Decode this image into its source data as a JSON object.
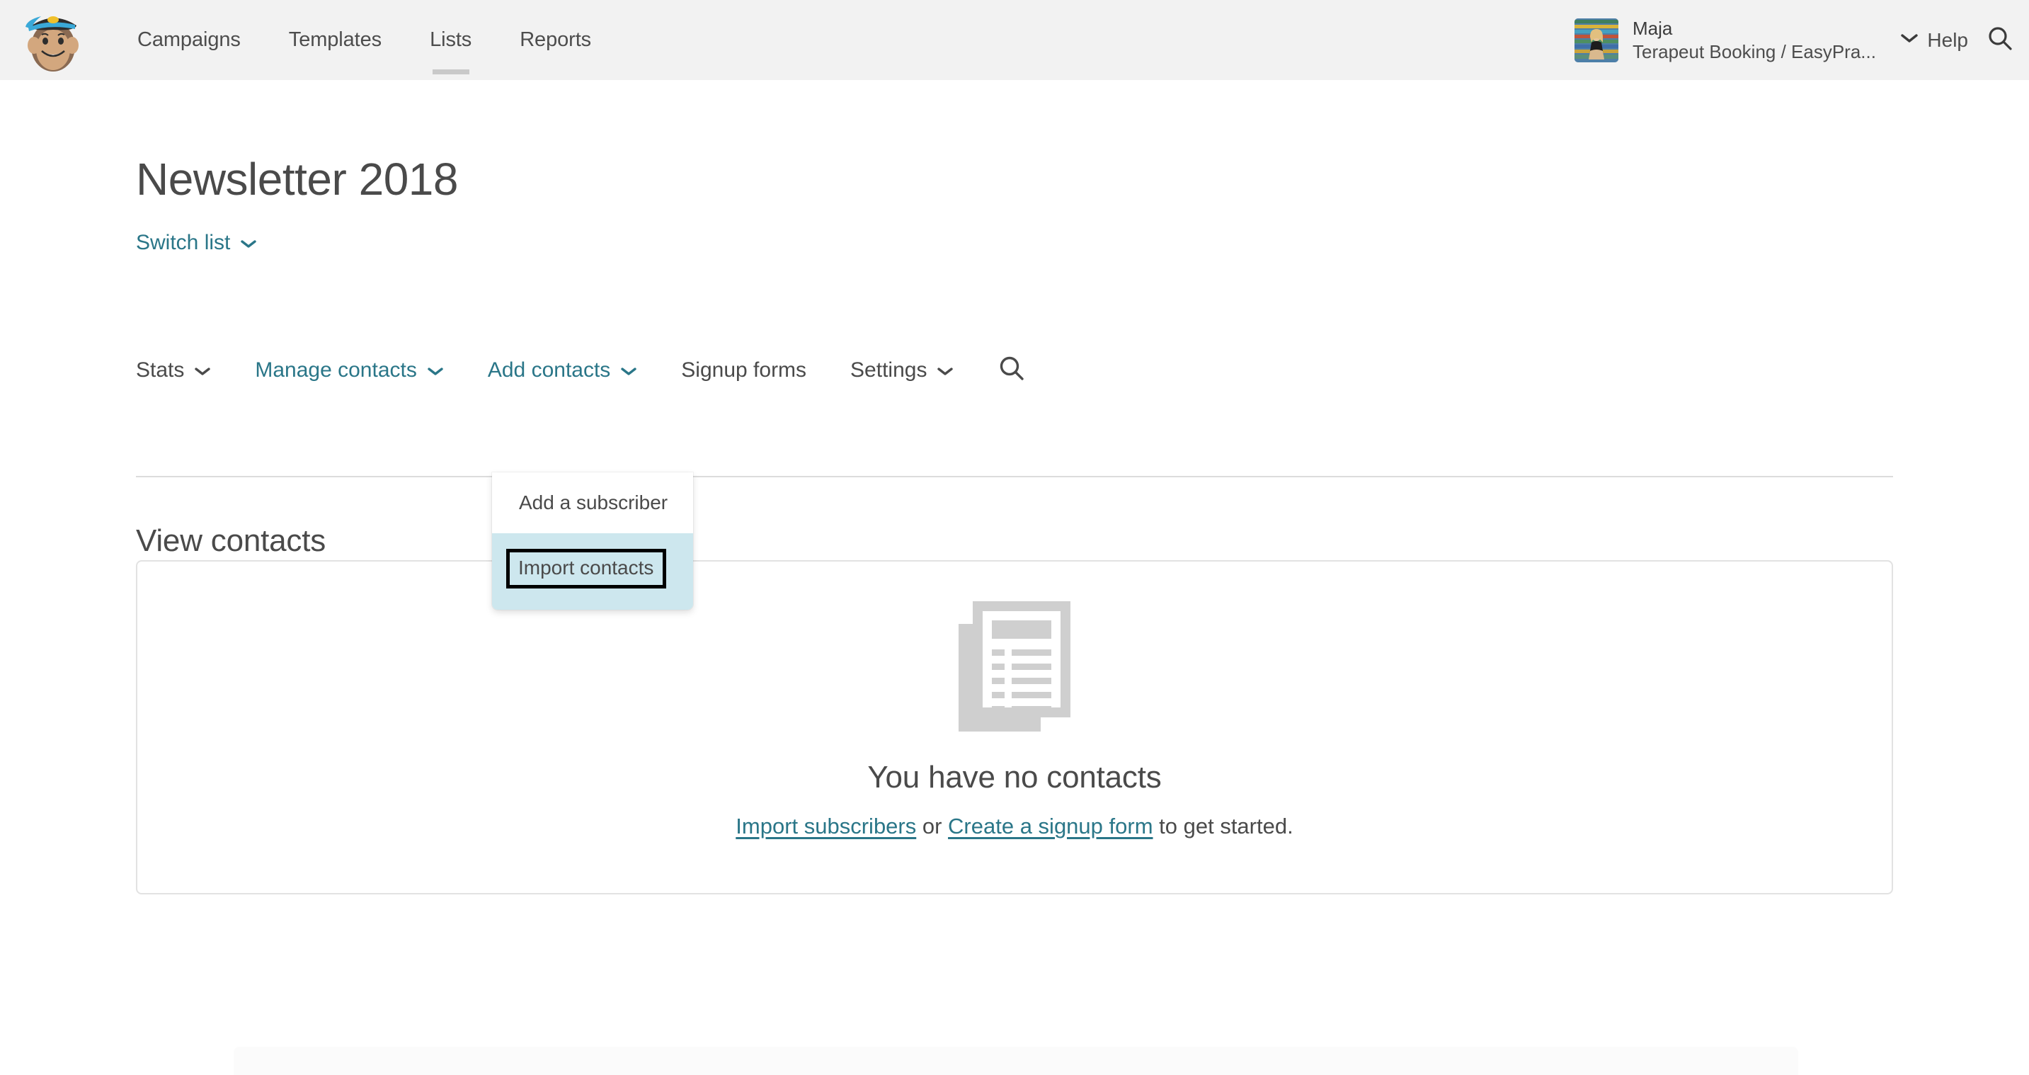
{
  "topnav": {
    "logo_icon": "mailchimp-freddie-logo",
    "items": [
      {
        "label": "Campaigns",
        "active": false
      },
      {
        "label": "Templates",
        "active": false
      },
      {
        "label": "Lists",
        "active": true
      },
      {
        "label": "Reports",
        "active": false
      }
    ],
    "account": {
      "name": "Maja",
      "org": "Terapeut Booking / EasyPra...",
      "avatar_icon": "user-avatar-photo",
      "caret_icon": "chevron-down-icon"
    },
    "help_label": "Help",
    "search_icon": "search-icon"
  },
  "page": {
    "title": "Newsletter 2018",
    "switch_list_label": "Switch list",
    "switch_list_caret_icon": "chevron-down-icon"
  },
  "tabs": [
    {
      "label": "Stats",
      "has_caret": true,
      "teal": false
    },
    {
      "label": "Manage contacts",
      "has_caret": true,
      "teal": true
    },
    {
      "label": "Add contacts",
      "has_caret": true,
      "teal": true
    },
    {
      "label": "Signup forms",
      "has_caret": false,
      "teal": false
    },
    {
      "label": "Settings",
      "has_caret": true,
      "teal": false
    }
  ],
  "tab_search_icon": "search-icon",
  "dropdown": {
    "open": true,
    "items": [
      {
        "label": "Add a subscriber",
        "highlighted": false
      },
      {
        "label": "Import contacts",
        "highlighted": true
      }
    ]
  },
  "section": {
    "title": "View contacts"
  },
  "empty_state": {
    "icon": "documents-icon",
    "title": "You have no contacts",
    "link_import": "Import subscribers",
    "text_or": " or ",
    "link_signup": "Create a signup form",
    "text_tail": " to get started."
  },
  "colors": {
    "teal": "#2a7688",
    "text_dark": "#4a4a4a",
    "header_bg": "#f2f2f2",
    "highlight_bg": "#cde7ee",
    "border": "#e2e2e2",
    "icon_gray": "#cfcfcf"
  }
}
